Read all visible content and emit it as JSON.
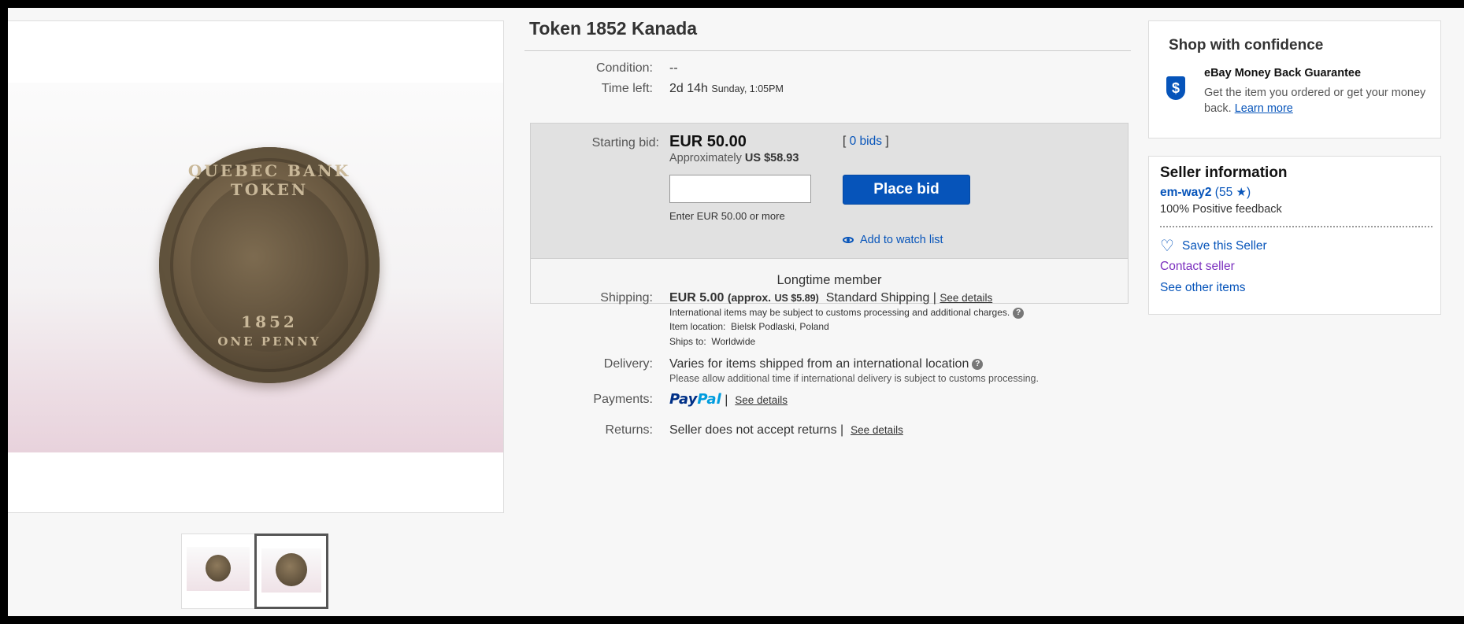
{
  "listing": {
    "title": "Token 1852 Kanada"
  },
  "image": {
    "coin_top_text": "QUEBEC BANK TOKEN",
    "coin_year": "1852",
    "coin_bottom_text": "ONE PENNY"
  },
  "details": {
    "condition_label": "Condition:",
    "condition_value": "--",
    "time_left_label": "Time left:",
    "time_left_value": "2d 14h",
    "time_left_end": "Sunday, 1:05PM"
  },
  "bid": {
    "starting_label": "Starting bid:",
    "amount": "EUR 50.00",
    "approx_prefix": "Approximately",
    "approx_amount": "US $58.93",
    "bids_open": "[",
    "bids_count": "0 bids",
    "bids_close": "]",
    "input_value": "",
    "hint": "Enter EUR 50.00 or more",
    "place_bid": "Place bid",
    "watch": "Add to watch list",
    "member": "Longtime member"
  },
  "shipping": {
    "label": "Shipping:",
    "amount": "EUR 5.00",
    "approx": "(approx.",
    "approx_amount": "US $5.89)",
    "service": "Standard Shipping |",
    "see_details": "See details",
    "intl_note": "International items may be subject to customs processing and additional charges.",
    "location_label": "Item location:",
    "location": "Bielsk Podlaski, Poland",
    "ships_to_label": "Ships to:",
    "ships_to": "Worldwide"
  },
  "delivery": {
    "label": "Delivery:",
    "value": "Varies for items shipped from an international location",
    "note": "Please allow additional time if international delivery is subject to customs processing."
  },
  "payments": {
    "label": "Payments:",
    "paypal_a": "Pay",
    "paypal_b": "Pal",
    "separator": "|",
    "see_details": "See details"
  },
  "returns": {
    "label": "Returns:",
    "value": "Seller does not accept returns |",
    "see_details": "See details"
  },
  "confidence": {
    "title": "Shop with confidence",
    "shield_symbol": "$",
    "guarantee_title": "eBay Money Back Guarantee",
    "guarantee_text": "Get the item you ordered or get your money back.",
    "learn_more": "Learn more"
  },
  "seller": {
    "title": "Seller information",
    "name": "em-way2",
    "score_open": "(55",
    "score_close": ")",
    "feedback": "100% Positive feedback",
    "save": "Save this Seller",
    "contact": "Contact seller",
    "other_items": "See other items"
  },
  "colors": {
    "link_blue": "#0654ba",
    "contact_purple": "#7b2fbe",
    "button_blue": "#0654ba"
  }
}
